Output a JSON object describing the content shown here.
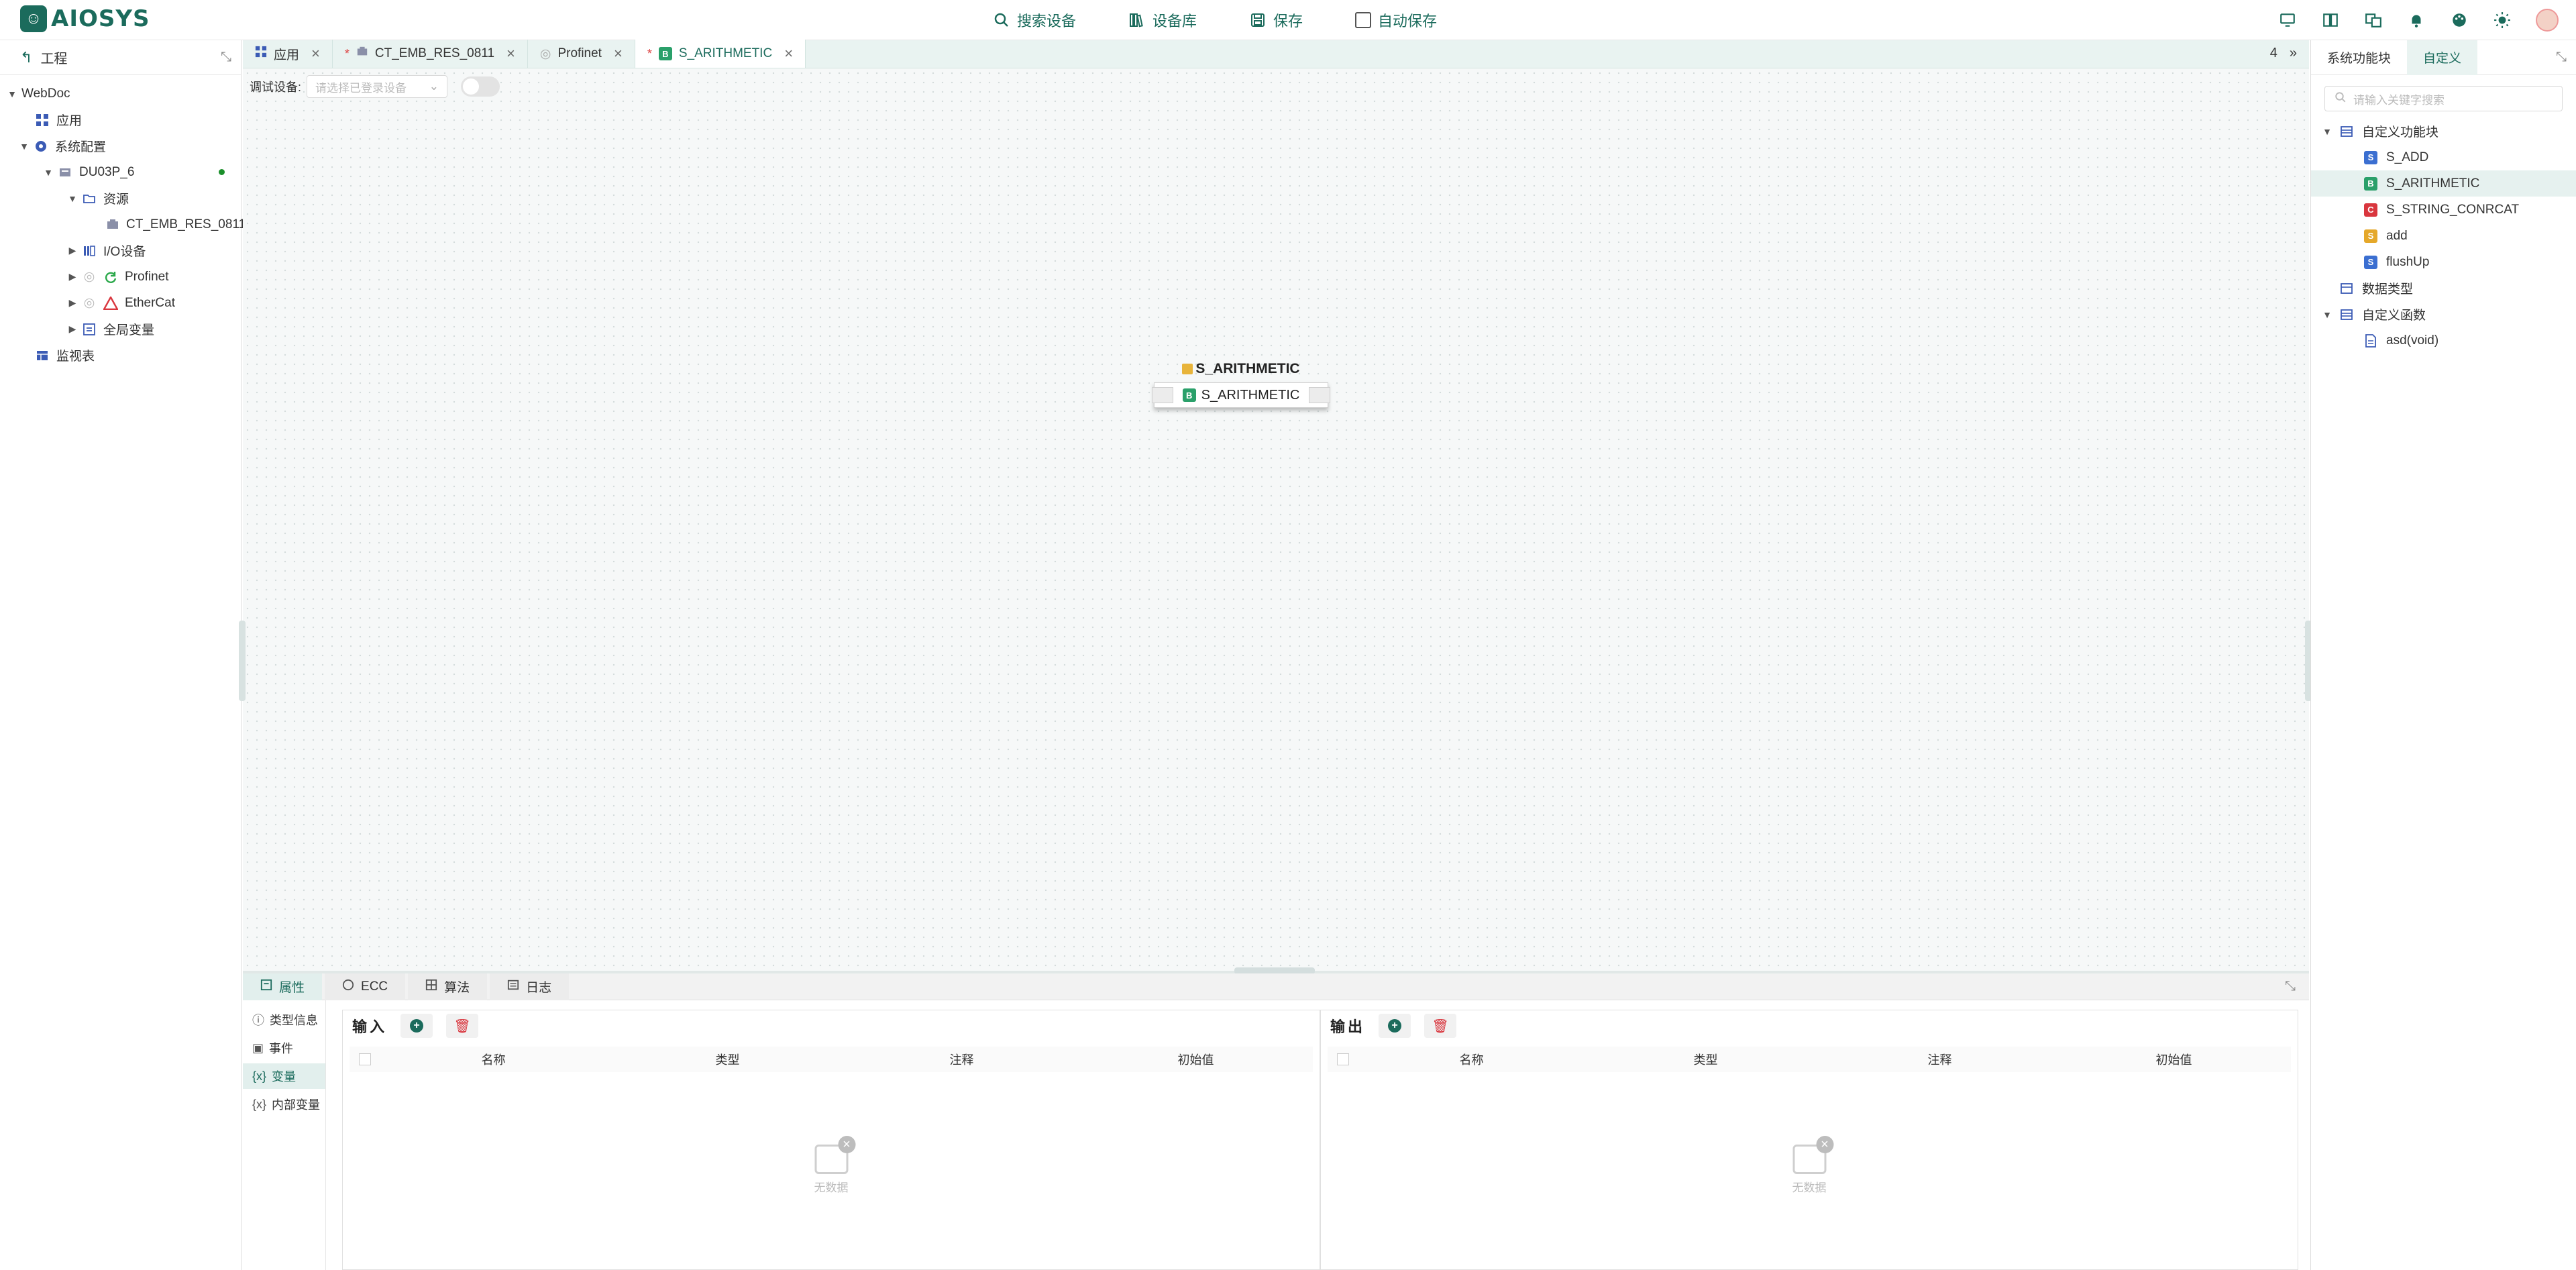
{
  "app": {
    "logo_text": "AIOSYS"
  },
  "toolbar": {
    "search_devices": "搜索设备",
    "device_library": "设备库",
    "save": "保存",
    "autosave": "自动保存"
  },
  "left_panel": {
    "header": "工程",
    "tree": {
      "root": "WebDoc",
      "app": "应用",
      "sysconfig": "系统配置",
      "device": "DU03P_6",
      "resources": "资源",
      "resource_item": "CT_EMB_RES_0811",
      "io": "I/O设备",
      "profinet": "Profinet",
      "ethercat": "EtherCat",
      "globals": "全局变量",
      "watch": "监视表"
    }
  },
  "tabs": [
    {
      "label": "应用",
      "modified": false
    },
    {
      "label": "CT_EMB_RES_0811",
      "modified": true
    },
    {
      "label": "Profinet",
      "modified": false
    },
    {
      "label": "S_ARITHMETIC",
      "modified": true
    }
  ],
  "tabs_modified_mark": "*",
  "tabs_count": "4",
  "canvas": {
    "debug_label": "调试设备:",
    "debug_placeholder": "请选择已登录设备",
    "block_title": "S_ARITHMETIC",
    "block_name": "S_ARITHMETIC"
  },
  "bottom": {
    "tabs": [
      "属性",
      "ECC",
      "算法",
      "日志"
    ],
    "side": [
      "类型信息",
      "事件",
      "变量",
      "内部变量"
    ],
    "input_title": "输入",
    "output_title": "输出",
    "columns": [
      "名称",
      "类型",
      "注释",
      "初始值"
    ],
    "empty": "无数据"
  },
  "right_panel": {
    "tabs": [
      "系统功能块",
      "自定义"
    ],
    "search_placeholder": "请输入关键字搜索",
    "groups": {
      "custom_fb": "自定义功能块",
      "datatypes": "数据类型",
      "custom_funcs": "自定义函数"
    },
    "items": [
      "S_ADD",
      "S_ARITHMETIC",
      "S_STRING_CONRCAT",
      "add",
      "flushUp"
    ],
    "func_item": "asd(void)"
  },
  "colors": {
    "accent": "#1b6b5c",
    "status_online": "#1a8f2a"
  }
}
